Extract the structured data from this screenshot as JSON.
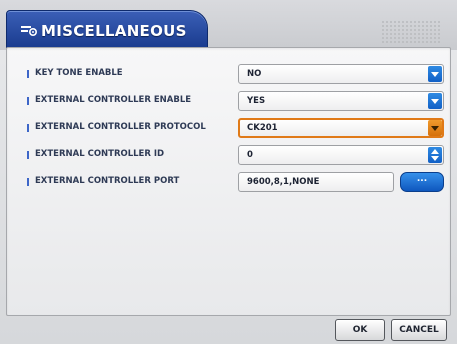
{
  "window": {
    "title": "MISCELLANEOUS",
    "title_icon": "settings-menu-icon"
  },
  "settings": [
    {
      "label": "KEY TONE ENABLE",
      "value": "NO",
      "control": "dropdown"
    },
    {
      "label": "EXTERNAL CONTROLLER ENABLE",
      "value": "YES",
      "control": "dropdown"
    },
    {
      "label": "EXTERNAL CONTROLLER PROTOCOL",
      "value": "CK201",
      "control": "dropdown",
      "focused": true
    },
    {
      "label": "EXTERNAL CONTROLLER ID",
      "value": "0",
      "control": "spinner"
    },
    {
      "label": "EXTERNAL CONTROLLER PORT",
      "value": "9600,8,1,NONE",
      "control": "text-with-button",
      "button_label": "..."
    }
  ],
  "footer": {
    "ok_label": "OK",
    "cancel_label": "CANCEL"
  },
  "colors": {
    "title_blue": "#1a3c8f",
    "dropdown_blue": "#1160c6",
    "focus_orange": "#e07a18"
  }
}
